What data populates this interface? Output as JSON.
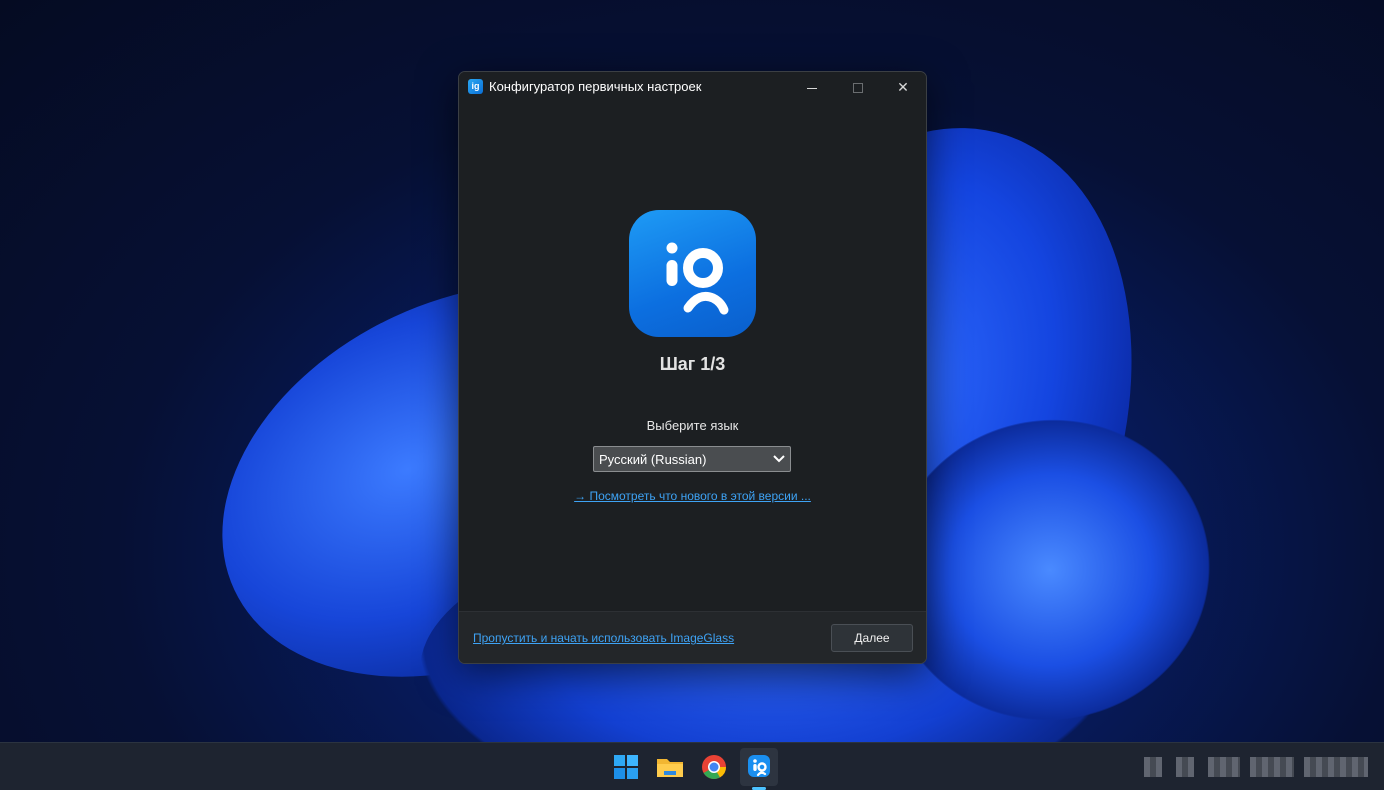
{
  "window": {
    "title": "Конфигуратор первичных настроек",
    "icon": "imageglass-app-icon"
  },
  "setup": {
    "step_title": "Шаг 1/3",
    "language_label": "Выберите язык",
    "language_selected": "Русский (Russian)",
    "whats_new_link": "→ Посмотреть что нового в этой версии ...",
    "skip_link": "Пропустить и начать использовать ImageGlass",
    "next_button": "Далее"
  },
  "taskbar": {
    "items": [
      "start-icon",
      "file-explorer-icon",
      "chrome-icon",
      "imageglass-icon"
    ],
    "active": "imageglass-icon"
  },
  "colors": {
    "dialog_bg": "#1c1f22",
    "link": "#3ea3f5",
    "accent": "#4cc2ff"
  }
}
